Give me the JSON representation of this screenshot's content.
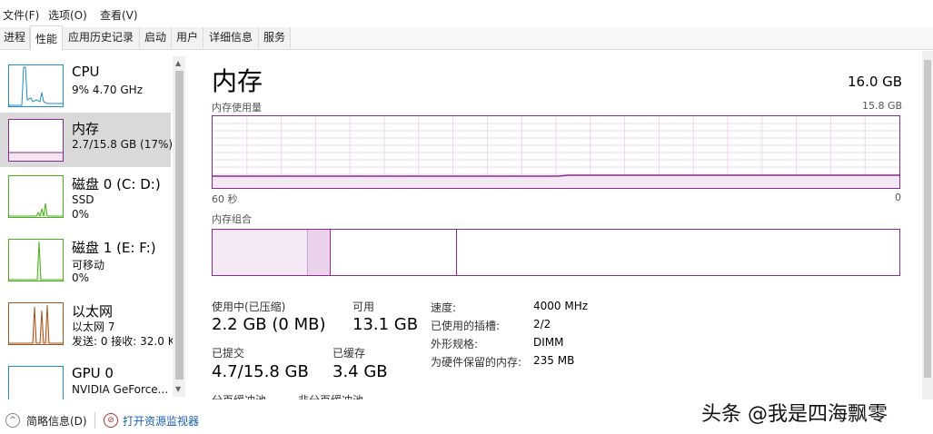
{
  "menu": [
    "文件(F)",
    "选项(O)",
    "查看(V)"
  ],
  "tabs": [
    "进程",
    "性能",
    "应用历史记录",
    "启动",
    "用户",
    "详细信息",
    "服务"
  ],
  "sidebar": {
    "items": [
      {
        "title": "CPU",
        "sub1": "9%  4.70 GHz",
        "sub2": ""
      },
      {
        "title": "内存",
        "sub1": "2.7/15.8 GB (17%)",
        "sub2": ""
      },
      {
        "title": "磁盘 0 (C: D:)",
        "sub1": "SSD",
        "sub2": "0%"
      },
      {
        "title": "磁盘 1 (E: F:)",
        "sub1": "可移动",
        "sub2": "0%"
      },
      {
        "title": "以太网",
        "sub1": "以太网 7",
        "sub2": "发送: 0  接收: 32.0 K"
      },
      {
        "title": "GPU 0",
        "sub1": "NVIDIA GeForce...",
        "sub2": ""
      }
    ]
  },
  "main": {
    "title": "内存",
    "total": "16.0 GB",
    "usage_label": "内存使用量",
    "usage_max": "15.8 GB",
    "time_left": "60 秒",
    "time_right": "0",
    "composition_label": "内存组合",
    "stats": {
      "in_use_label": "使用中(已压缩)",
      "in_use_value": "2.2 GB (0 MB)",
      "available_label": "可用",
      "available_value": "13.1 GB",
      "committed_label": "已提交",
      "committed_value": "4.7/15.8 GB",
      "cached_label": "已缓存",
      "cached_value": "3.4 GB",
      "paged_label": "分页缓冲池",
      "nonpaged_label": "非分页缓冲池"
    },
    "info": [
      {
        "label": "速度:",
        "value": "4000 MHz"
      },
      {
        "label": "已使用的插槽:",
        "value": "2/2"
      },
      {
        "label": "外形规格:",
        "value": "DIMM"
      },
      {
        "label": "为硬件保留的内存:",
        "value": "235 MB"
      }
    ]
  },
  "footer": {
    "brief": "简略信息(D)",
    "monitor": "打开资源监视器"
  },
  "watermark": "头条 @我是四海飘零",
  "colors": {
    "memory": "#8b2b8b",
    "cpu": "#1d8fc7",
    "disk": "#4caf1c",
    "ethernet": "#a3541c"
  }
}
